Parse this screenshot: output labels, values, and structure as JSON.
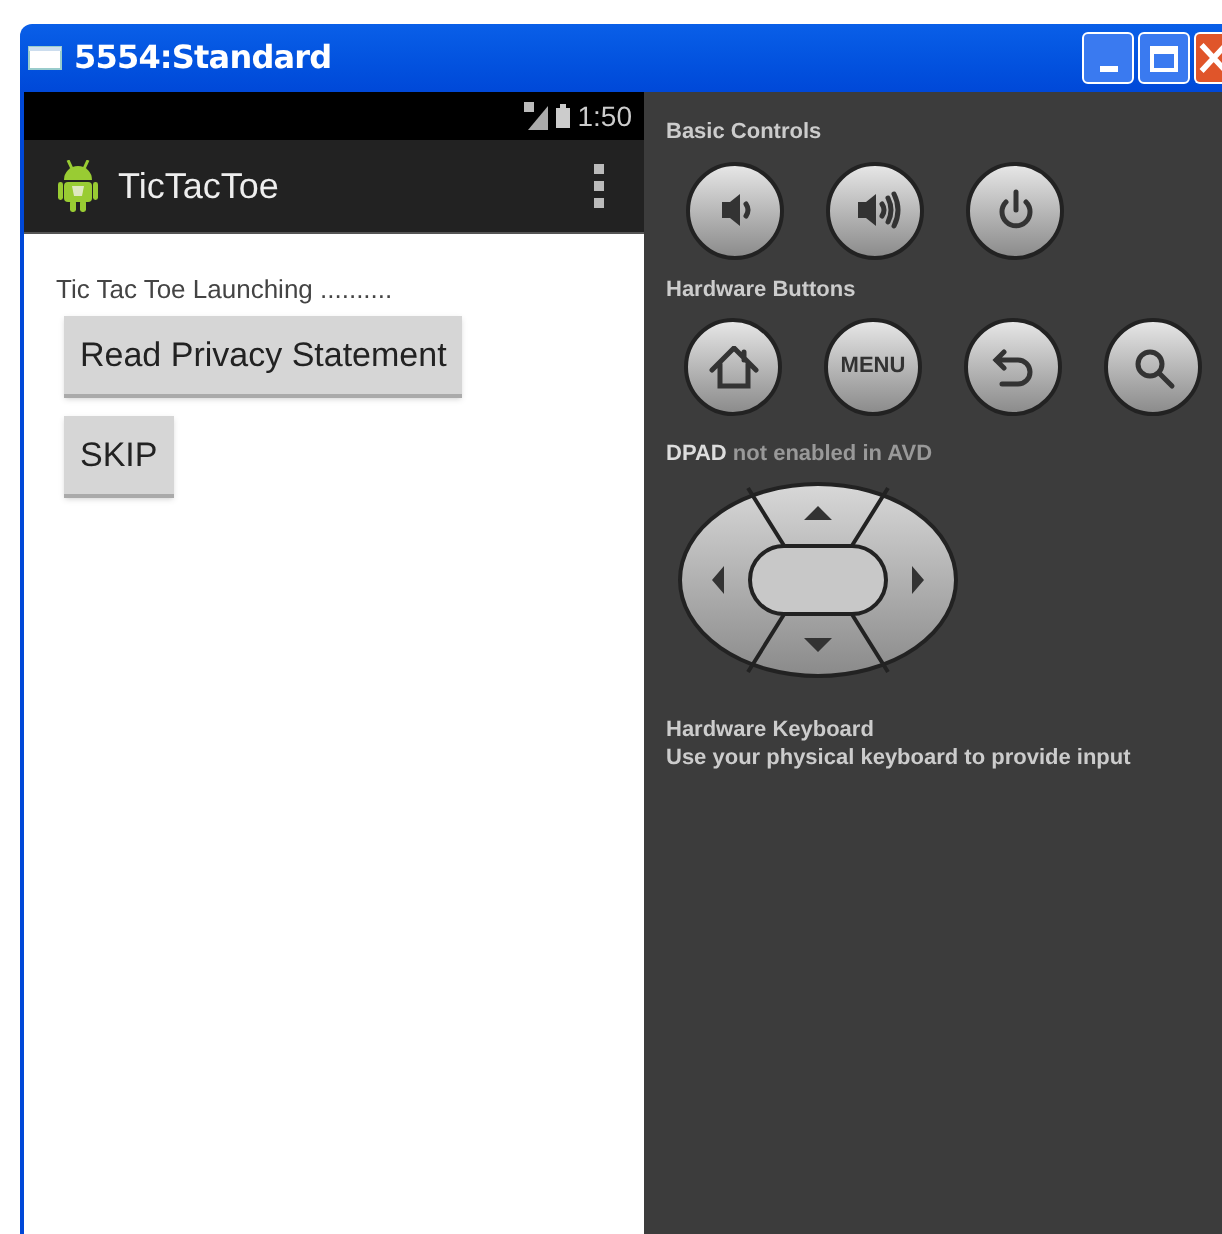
{
  "window": {
    "title": "5554:Standard"
  },
  "phone": {
    "status_bar": {
      "time": "1:50"
    },
    "action_bar": {
      "title": "TicTacToe"
    },
    "message": "Tic Tac Toe Launching ..........",
    "buttons": [
      "Read Privacy Statement",
      "SKIP"
    ]
  },
  "controls": {
    "basic_title": "Basic Controls",
    "basic_buttons": [
      {
        "kind": "volume-down"
      },
      {
        "kind": "volume-up"
      },
      {
        "kind": "power"
      }
    ],
    "hardware_title": "Hardware Buttons",
    "hardware_buttons": [
      {
        "kind": "home"
      },
      {
        "kind": "menu",
        "label": "MENU"
      },
      {
        "kind": "back"
      },
      {
        "kind": "search"
      }
    ],
    "dpad_note": "**DPAD** not enabled in AVD",
    "keyboard_title": "Hardware Keyboard",
    "keyboard_note": "Use your physical keyboard to provide input"
  }
}
